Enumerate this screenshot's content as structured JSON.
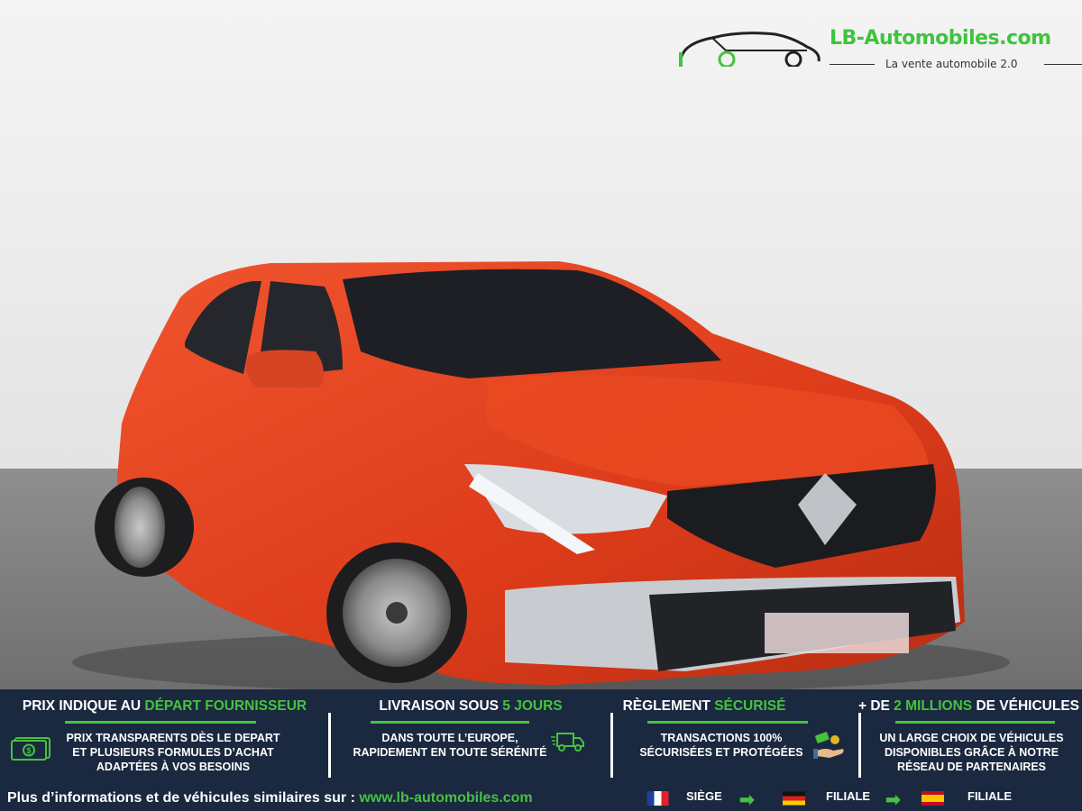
{
  "brand": {
    "name": "LB-Automobiles.com",
    "tagline": "La vente automobile 2.0"
  },
  "colors": {
    "banner_bg": "#1a2940",
    "accent": "#46c23c",
    "car_body": "#e2401f"
  },
  "panels": [
    {
      "title_pre": "PRIX INDIQUE AU ",
      "title_accent": "DÉPART FOURNISSEUR",
      "title_post": "",
      "lines": [
        "PRIX TRANSPARENTS DÈS LE DEPART",
        "ET PLUSIEURS FORMULES D’ACHAT",
        "ADAPTÉES À VOS BESOINS"
      ],
      "icon": "money-icon"
    },
    {
      "title_pre": "LIVRAISON SOUS ",
      "title_accent": "5 JOURS",
      "title_post": "",
      "lines": [
        "DANS TOUTE L’EUROPE,",
        "RAPIDEMENT EN TOUTE SÉRÉNITÉ"
      ],
      "icon": "delivery-truck-icon"
    },
    {
      "title_pre": "RÈGLEMENT ",
      "title_accent": "SÉCURISÉ",
      "title_post": "",
      "lines": [
        "TRANSACTIONS 100%",
        "SÉCURISÉES ET PROTÉGÉES"
      ],
      "icon": "payment-hand-icon"
    },
    {
      "title_pre": "+ DE ",
      "title_accent": "2 MILLIONS",
      "title_post": " DE VÉHICULES",
      "lines": [
        "UN LARGE CHOIX DE VÉHICULES",
        "DISPONIBLES GRÂCE À NOTRE",
        "RÉSEAU DE PARTENAIRES"
      ],
      "icon": ""
    }
  ],
  "footer": {
    "text": "Plus d’informations et de véhicules similaires sur : ",
    "url": "www.lb-automobiles.com",
    "locations": [
      {
        "label": "SIÈGE",
        "flag": "france-flag-icon"
      },
      {
        "label": "FILIALE",
        "flag": "germany-flag-icon"
      },
      {
        "label": "FILIALE",
        "flag": "spain-flag-icon"
      }
    ]
  }
}
